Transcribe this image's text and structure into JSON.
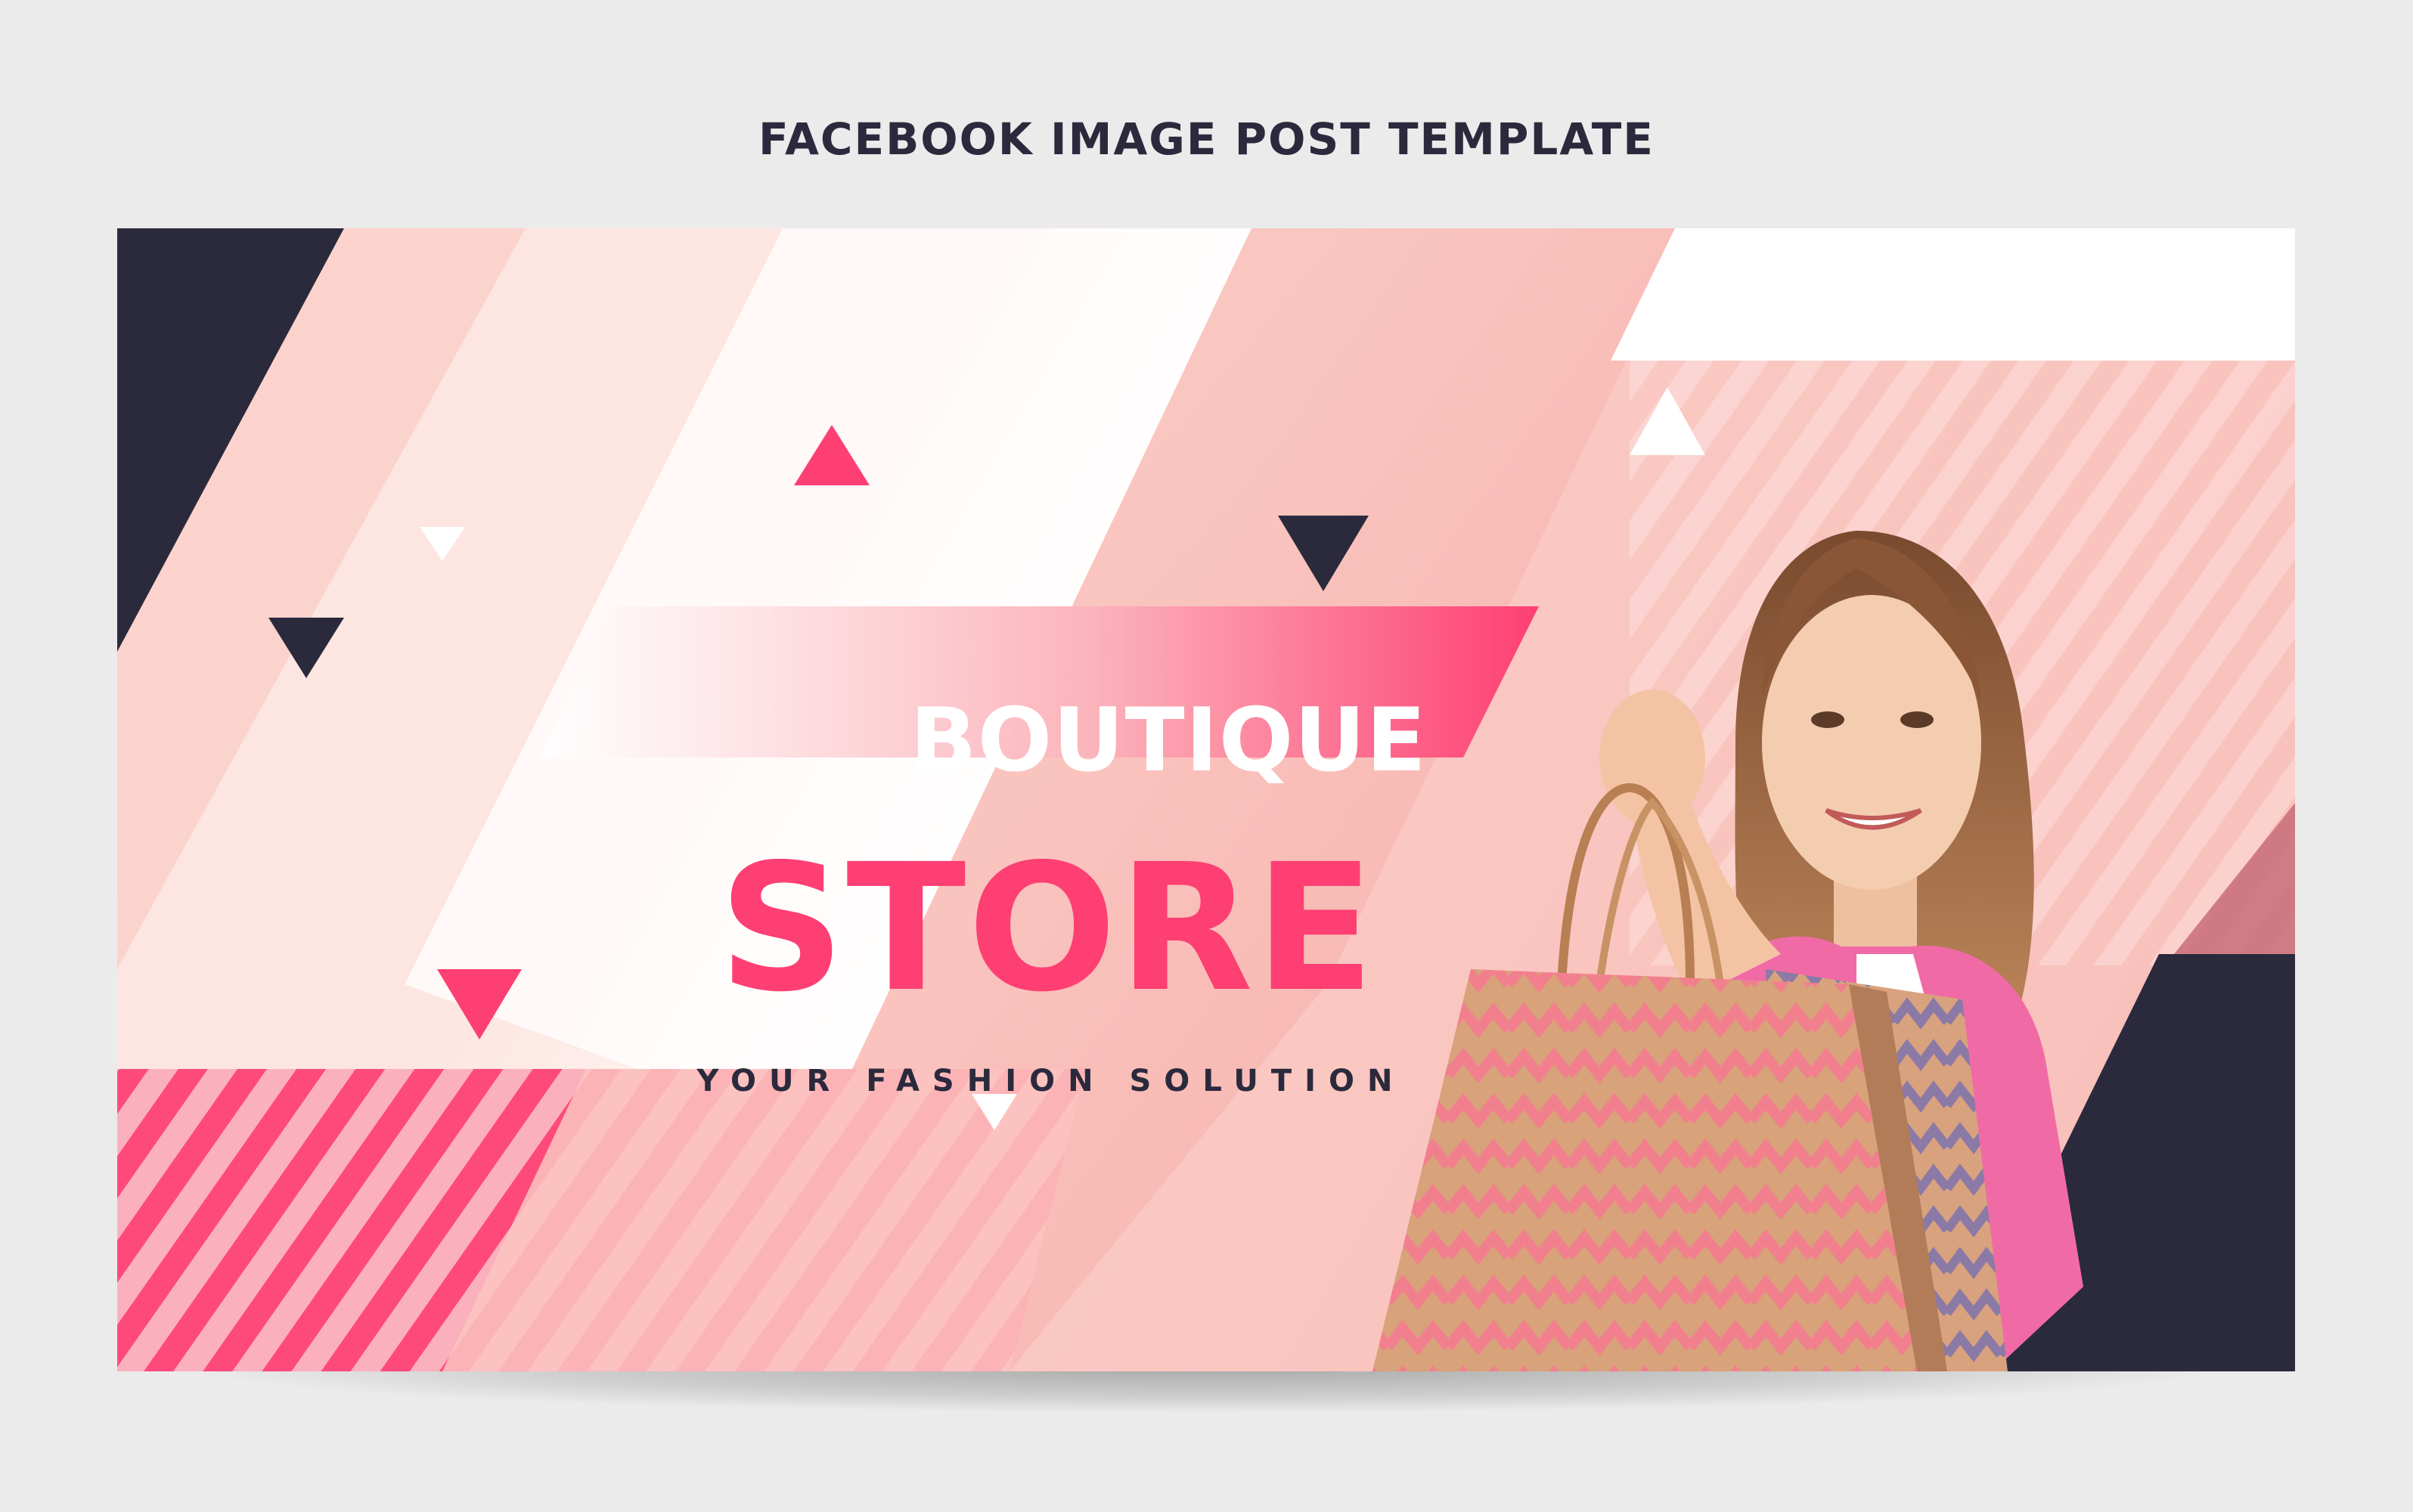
{
  "header": {
    "title": "FACEBOOK IMAGE POST TEMPLATE"
  },
  "banner": {
    "headline_top": "BOUTIQUE",
    "headline_main": "STORE",
    "tagline": "YOUR FASHION SOLUTION"
  },
  "colors": {
    "accent_pink": "#fe3f73",
    "navy": "#2b2a3d",
    "blush": "#fbd5cf",
    "background": "#ebebeb"
  },
  "icons": [
    "triangle-decor-icon",
    "shopping-bag-icon"
  ]
}
